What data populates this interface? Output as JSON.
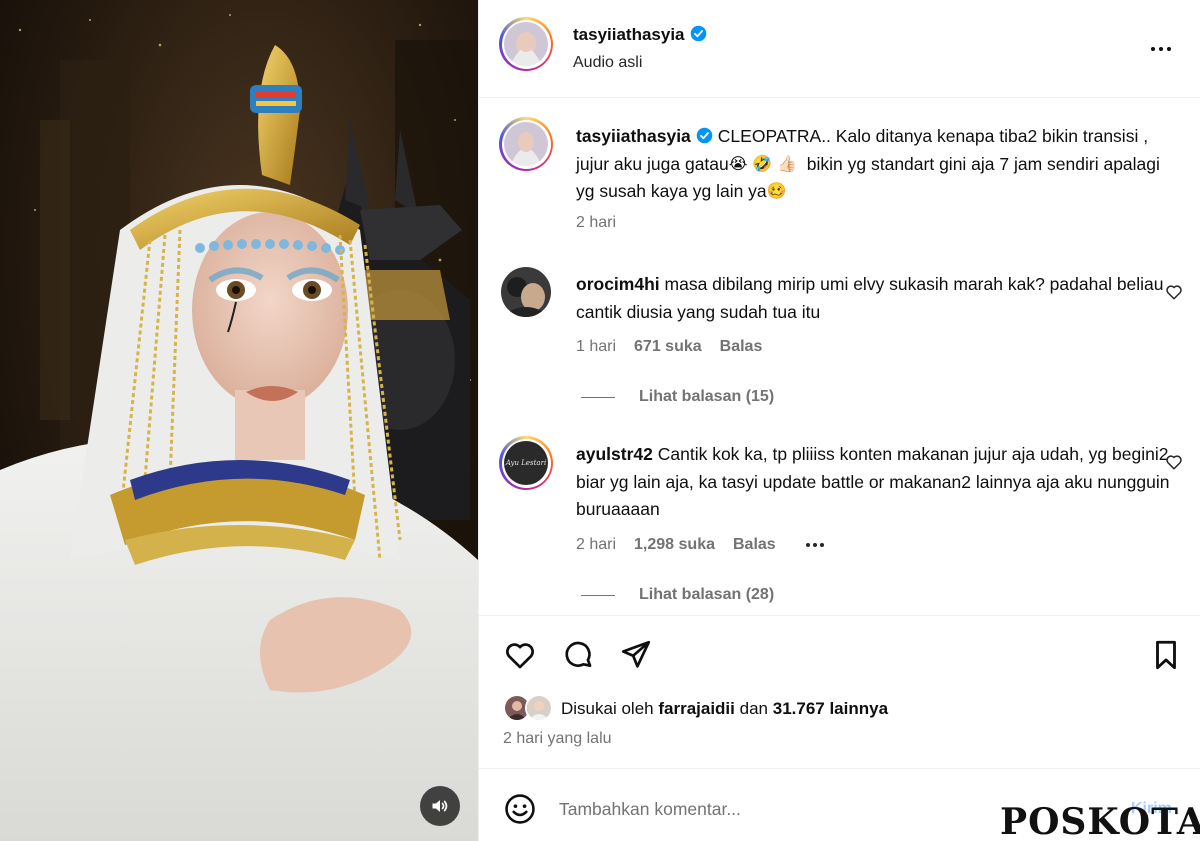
{
  "post_header": {
    "username": "tasyiiathasyia",
    "audio": "Audio asli"
  },
  "caption": {
    "username": "tasyiiathasyia",
    "text": "CLEOPATRA.. Kalo ditanya kenapa tiba2 bikin transisi , jujur aku juga gatau",
    "emojis": [
      "😭",
      "🤣",
      "👍🏻"
    ],
    "text2": "bikin yg standart gini aja 7 jam sendiri apalagi yg susah kaya yg lain ya",
    "emoji_end": "🥴",
    "time": "2 hari"
  },
  "comments": [
    {
      "username": "orocim4hi",
      "text": "masa dibilang mirip umi elvy sukasih marah kak? padahal beliau cantik diusia yang sudah tua itu",
      "time": "1 hari",
      "likes": "671 suka",
      "reply": "Balas",
      "view_replies": "Lihat balasan (15)"
    },
    {
      "username": "ayulstr42",
      "text": "Cantik kok ka, tp pliiiss konten makanan jujur aja udah, yg begini2 biar yg lain aja, ka tasyi update battle or makanan2 lainnya aja aku nungguin buruaaaan",
      "time": "2 hari",
      "likes": "1,298 suka",
      "reply": "Balas",
      "avatar_text": "Ayu Lestari",
      "view_replies": "Lihat balasan (28)"
    }
  ],
  "likes": {
    "prefix": "Disukai oleh",
    "user": "farrajaidii",
    "middle": "dan",
    "count": "31.767 lainnya"
  },
  "date": "2 hari yang lalu",
  "add_comment": {
    "placeholder": "Tambahkan komentar...",
    "post_label": "Kirim"
  },
  "watermark": "POSKOTA",
  "colors": {
    "verified": "#0095f6",
    "muted": "#737373",
    "post_button": "#a8cbf7"
  }
}
